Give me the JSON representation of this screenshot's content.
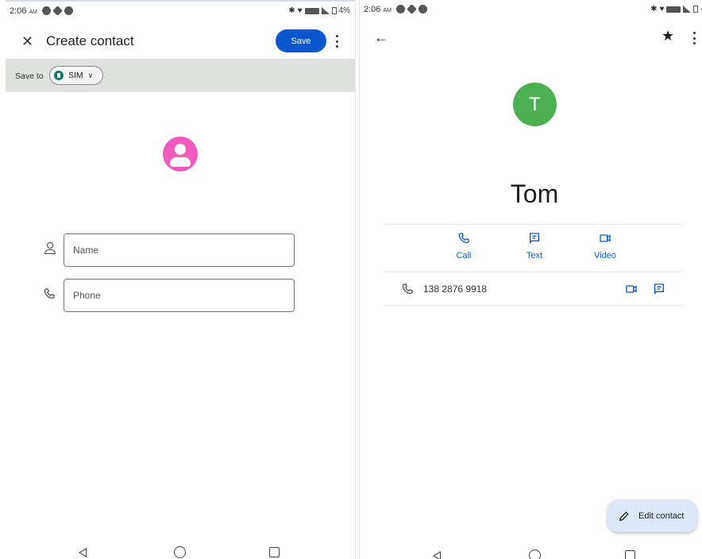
{
  "status_bar": {
    "left_time": "2:06",
    "left_ampm": "AM",
    "left_battery": "4%",
    "right_time": "2:06",
    "right_ampm": "AM",
    "right_battery": "4"
  },
  "create_contact": {
    "title": "Create contact",
    "save_label": "Save",
    "save_to_label": "Save to",
    "account_chip": "SIM",
    "name_placeholder": "Name",
    "phone_placeholder": "Phone"
  },
  "contact_detail": {
    "avatar_initial": "T",
    "name": "Tom",
    "actions": [
      {
        "label": "Call",
        "icon": "phone-icon"
      },
      {
        "label": "Text",
        "icon": "message-icon"
      },
      {
        "label": "Video",
        "icon": "video-icon"
      }
    ],
    "phone_number": "138 2876 9918",
    "edit_label": "Edit contact"
  },
  "colors": {
    "accent_blue": "#0b57d0",
    "avatar_pink": "#f05bbd",
    "avatar_green": "#4caf50",
    "save_to_bar": "#dfe1df",
    "fab_bg": "#dce7fa"
  }
}
